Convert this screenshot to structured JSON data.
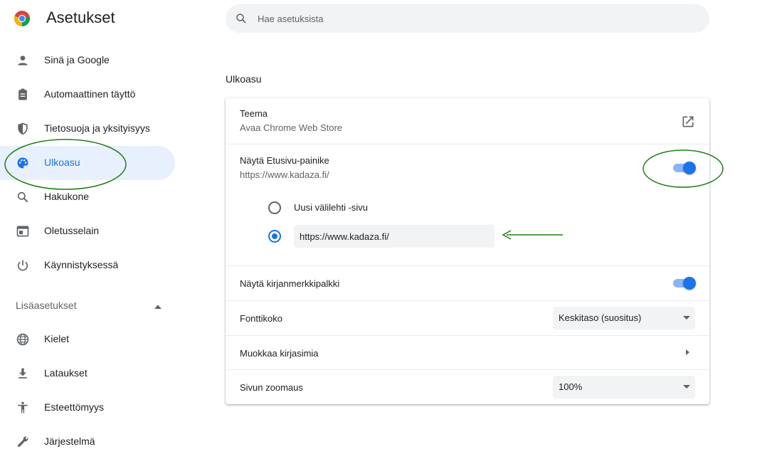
{
  "app": {
    "title": "Asetukset"
  },
  "search": {
    "placeholder": "Hae asetuksista"
  },
  "sidebar": {
    "items": [
      {
        "label": "Sinä ja Google",
        "icon": "person-icon"
      },
      {
        "label": "Automaattinen täyttö",
        "icon": "clipboard-icon"
      },
      {
        "label": "Tietosuoja ja yksityisyys",
        "icon": "shield-icon"
      },
      {
        "label": "Ulkoasu",
        "icon": "palette-icon",
        "active": true
      },
      {
        "label": "Hakukone",
        "icon": "search-icon"
      },
      {
        "label": "Oletusselain",
        "icon": "browser-icon"
      },
      {
        "label": "Käynnistyksessä",
        "icon": "power-icon"
      }
    ],
    "advanced": {
      "label": "Lisäasetukset",
      "expanded": true,
      "items": [
        {
          "label": "Kielet",
          "icon": "globe-icon"
        },
        {
          "label": "Lataukset",
          "icon": "download-icon"
        },
        {
          "label": "Esteettömyys",
          "icon": "accessibility-icon"
        },
        {
          "label": "Järjestelmä",
          "icon": "wrench-icon"
        }
      ]
    }
  },
  "main": {
    "heading": "Ulkoasu",
    "theme": {
      "title": "Teema",
      "subtitle": "Avaa Chrome Web Store"
    },
    "home_button": {
      "title": "Näytä Etusivu-painike",
      "subtitle": "https://www.kadaza.fi/",
      "enabled": true,
      "options": [
        {
          "label": "Uusi välilehti -sivu",
          "selected": false
        },
        {
          "value": "https://www.kadaza.fi/",
          "selected": true
        }
      ]
    },
    "bookmarks_bar": {
      "title": "Näytä kirjanmerkkipalkki",
      "enabled": true
    },
    "font_size": {
      "title": "Fonttikoko",
      "value": "Keskitaso (suositus)"
    },
    "customize_fonts": {
      "title": "Muokkaa kirjasimia"
    },
    "page_zoom": {
      "title": "Sivun zoomaus",
      "value": "100%"
    }
  },
  "colors": {
    "accent": "#1a73e8",
    "annotation": "#1e7e14",
    "active_bg": "#e8f0fe"
  }
}
